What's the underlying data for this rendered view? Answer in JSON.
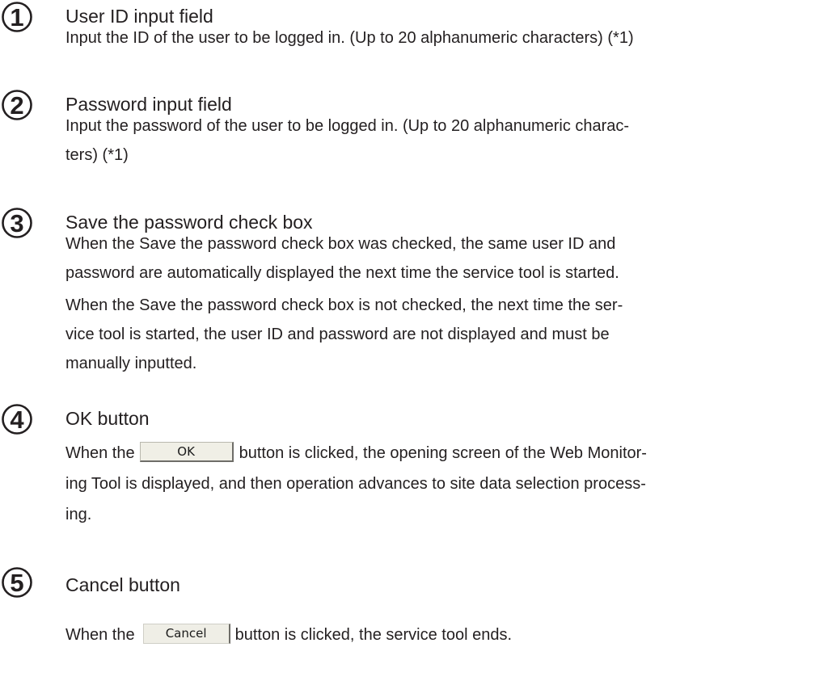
{
  "items": [
    {
      "number": "1",
      "title": "User ID input field",
      "lines": [
        "Input the ID of the user to be logged in. (Up to 20 alphanumeric characters) (*1)"
      ]
    },
    {
      "number": "2",
      "title": "Password input field",
      "lines": [
        "Input the password of the user to be logged in. (Up to 20 alphanumeric charac-",
        "ters) (*1)"
      ]
    },
    {
      "number": "3",
      "title": "Save the password check box",
      "lines": [
        "When the Save the password check box was checked, the same user ID and",
        "password are automatically displayed the next time the service tool is started.",
        "When the Save the password check box is not checked, the next time the ser-",
        "vice tool is started, the user ID and password are not displayed and must be",
        "manually inputted."
      ]
    },
    {
      "number": "4",
      "title": "OK button",
      "line1_before": "When the",
      "button_label": "OK",
      "line1_after": "button is clicked, the opening screen of the Web Monitor-",
      "lines": [
        "ing Tool is displayed, and then operation advances to site data selection process-",
        "ing."
      ]
    },
    {
      "number": "5",
      "title": "Cancel button",
      "line1_before": "When the",
      "button_label": "Cancel",
      "line1_after": "button is clicked, the service tool ends."
    }
  ]
}
